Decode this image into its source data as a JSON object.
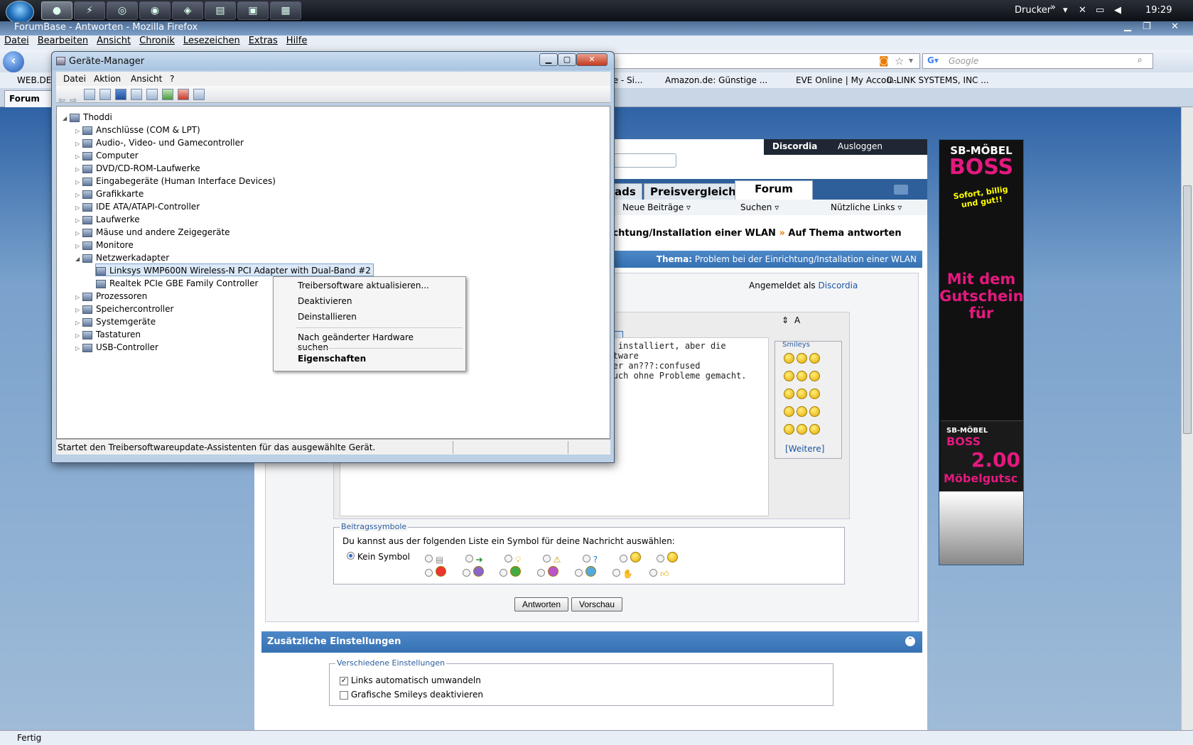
{
  "taskbar": {
    "tray_label": "Drucker",
    "clock": "19:29",
    "chevron": "»"
  },
  "firefox": {
    "title": "ForumBase - Antworten - Mozilla Firefox",
    "menu": [
      "Datei",
      "Bearbeiten",
      "Ansicht",
      "Chronik",
      "Lesezeichen",
      "Extras",
      "Hilfe"
    ],
    "search_placeholder": "Google",
    "bookmarks": [
      "WEB.DE E",
      "te - Si...",
      "Amazon.de: Günstige ...",
      "EVE Online | My Accou...",
      "D-LINK SYSTEMS, INC ..."
    ],
    "tab_label": "Forum",
    "status": "Fertig"
  },
  "forum": {
    "user_link": "Discordia",
    "logout": "Ausloggen",
    "tabs": [
      "ads",
      "Preisvergleich",
      "Forum"
    ],
    "subnav": [
      "Neue Beiträge",
      "Suchen",
      "Nützliche Links"
    ],
    "breadcrumb_a": "ichtung/Installation einer WLAN",
    "breadcrumb_sep": "»",
    "breadcrumb_b": "Auf Thema antworten",
    "thema_label": "Thema:",
    "thema_value": "Problem bei der Einrichtung/Installation einer WLAN",
    "logged_in_label": "Angemeldet als",
    "logged_in_user": "Discordia",
    "message_lines": [
      "und installiert, aber die Software",
      "apter an???:confused",
      "r auch ohne Probleme gemacht."
    ],
    "smileys_title": "Smileys",
    "smileys_more": "[Weitere]",
    "symbols_legend": "Beitragssymbole",
    "symbols_text": "Du kannst aus der folgenden Liste ein Symbol für deine Nachricht auswählen:",
    "no_symbol": "Kein Symbol",
    "btn_reply": "Antworten",
    "btn_preview": "Vorschau",
    "extra_title": "Zusätzliche Einstellungen",
    "misc_legend": "Verschiedene Einstellungen",
    "opt1": "Links automatisch umwandeln",
    "opt2": "Grafische Smileys deaktivieren"
  },
  "ad": {
    "brand_top": "SB-MÖBEL",
    "brand": "BOSS",
    "slogan": "Sofort, billig und gut!!",
    "line1": "Mit dem",
    "line2": "Gutschein",
    "line3": "für",
    "brand_top2": "SB-MÖBEL",
    "brand2": "BOSS",
    "price": "2.00",
    "caption": "Möbelgutsc"
  },
  "devmgr": {
    "title": "Geräte-Manager",
    "menu": [
      "Datei",
      "Aktion",
      "Ansicht",
      "?"
    ],
    "root": "Thoddi",
    "nodes": [
      "Anschlüsse (COM & LPT)",
      "Audio-, Video- und Gamecontroller",
      "Computer",
      "DVD/CD-ROM-Laufwerke",
      "Eingabegeräte (Human Interface Devices)",
      "Grafikkarte",
      "IDE ATA/ATAPI-Controller",
      "Laufwerke",
      "Mäuse und andere Zeigegeräte",
      "Monitore",
      "Netzwerkadapter"
    ],
    "children": [
      "Linksys WMP600N Wireless-N PCI Adapter with Dual-Band #2",
      "Realtek PCIe GBE Family Controller"
    ],
    "nodes_after": [
      "Prozessoren",
      "Speichercontroller",
      "Systemgeräte",
      "Tastaturen",
      "USB-Controller"
    ],
    "status": "Startet den Treibersoftwareupdate-Assistenten für das ausgewählte Gerät.",
    "context": [
      "Treibersoftware aktualisieren...",
      "Deaktivieren",
      "Deinstallieren",
      "Nach geänderter Hardware suchen",
      "Eigenschaften"
    ]
  }
}
